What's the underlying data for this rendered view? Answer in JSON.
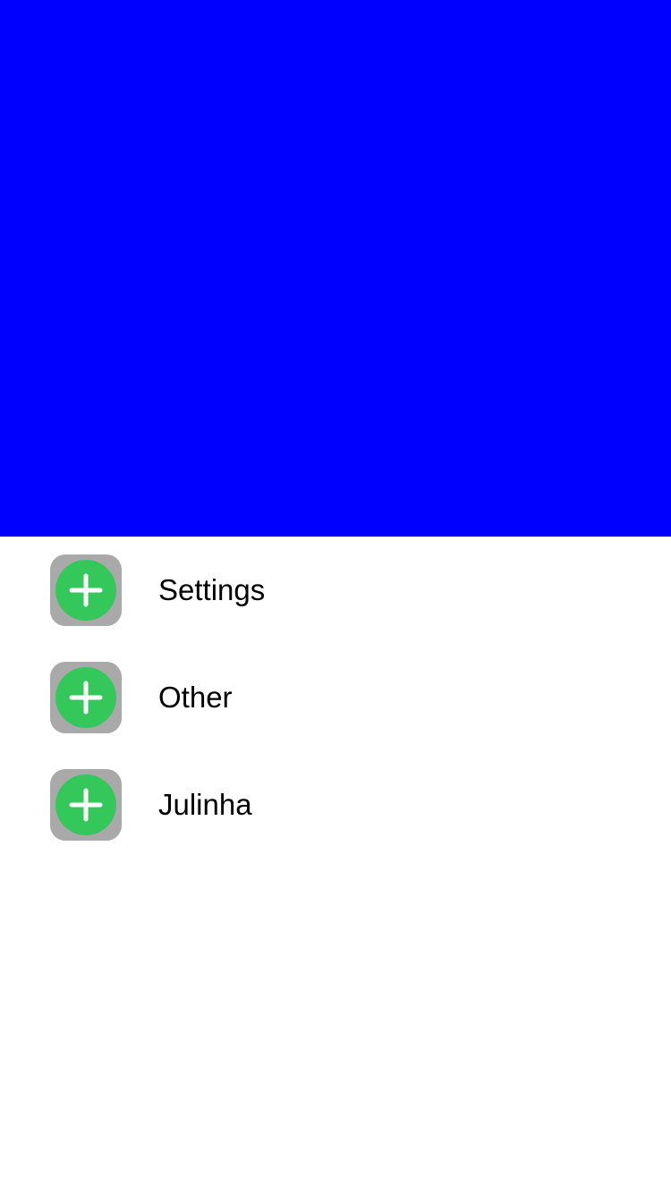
{
  "header": {
    "color": "#0000ff"
  },
  "menu": {
    "icon_tile_color": "#a9a9a9",
    "icon_circle_color": "#34c759",
    "icon_name": "plus-circle-icon",
    "items": [
      {
        "label": "Settings"
      },
      {
        "label": "Other"
      },
      {
        "label": "Julinha"
      }
    ]
  }
}
